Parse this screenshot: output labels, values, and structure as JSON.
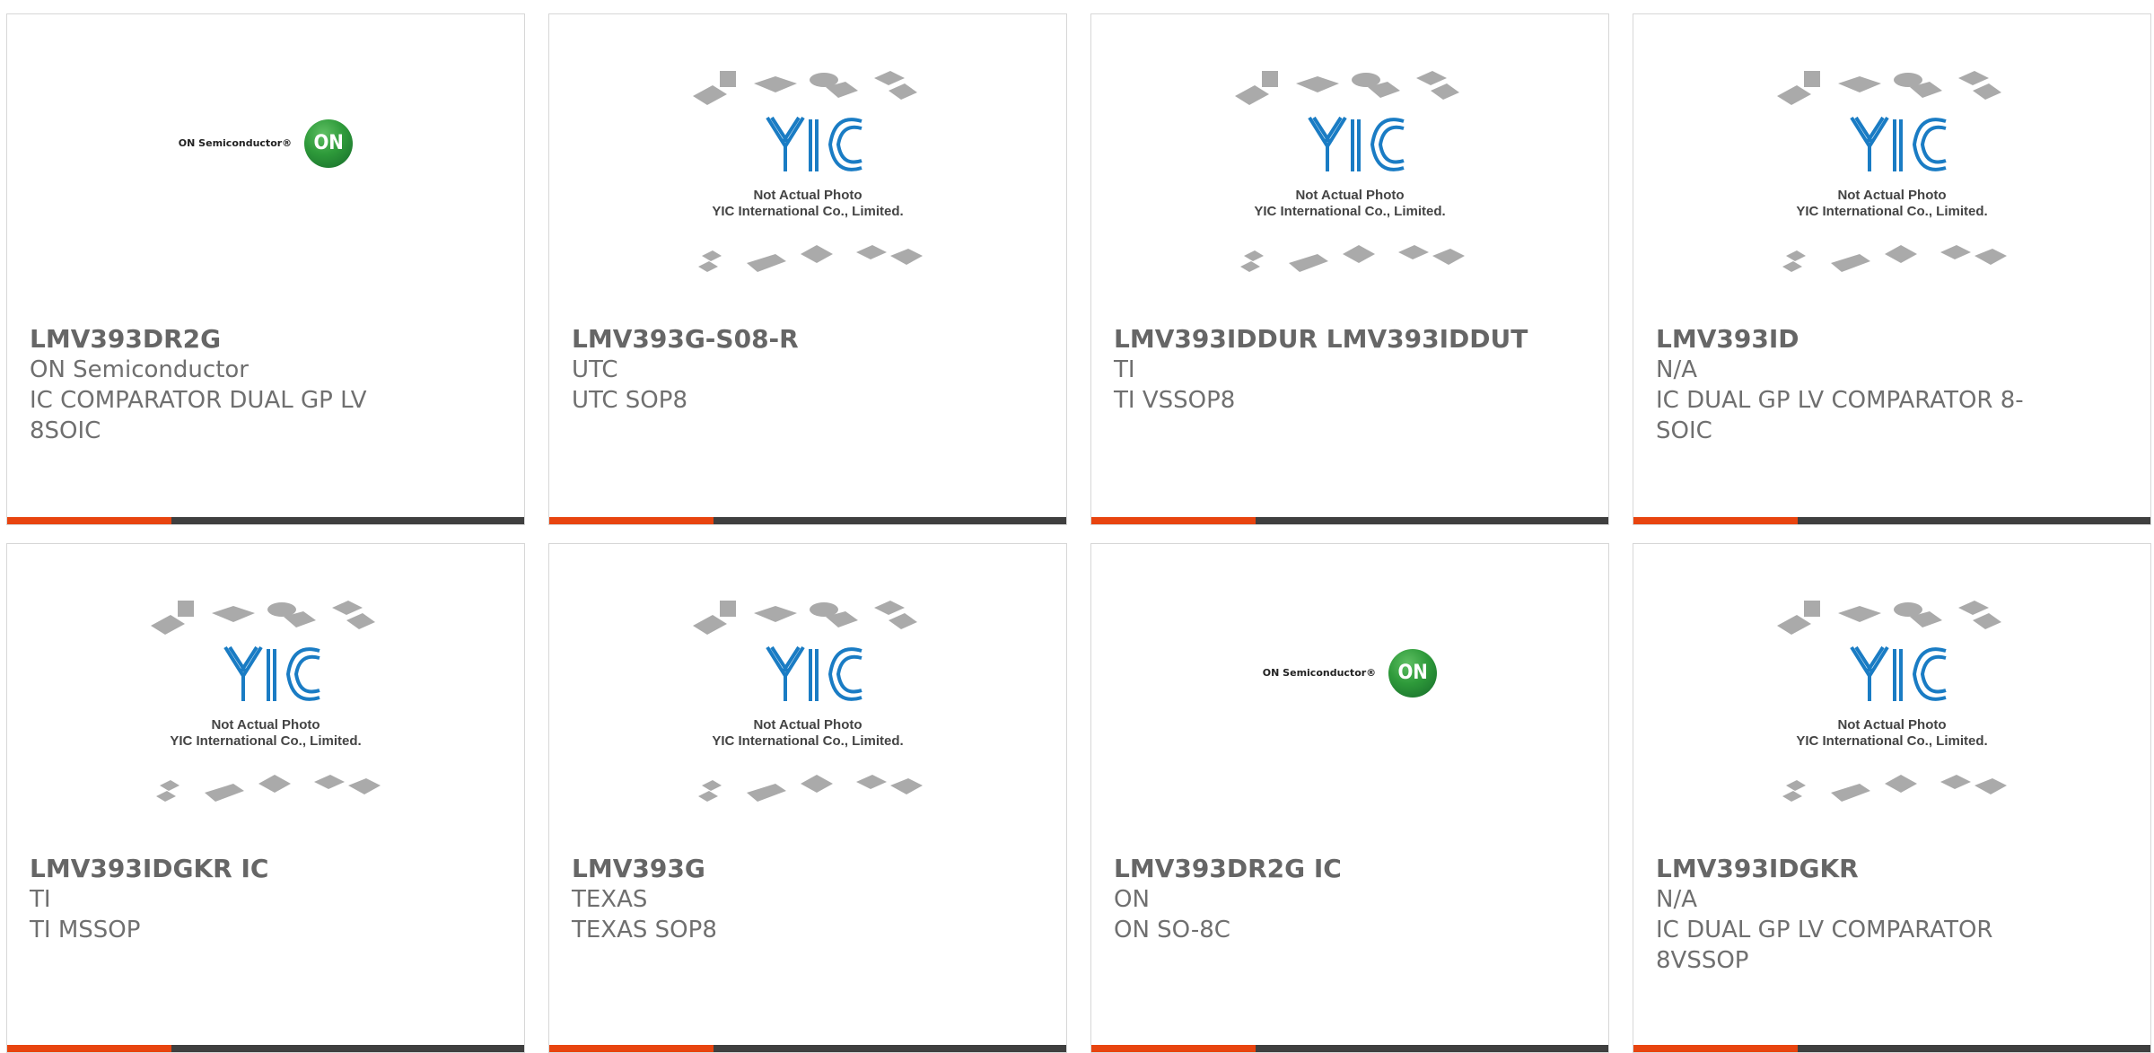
{
  "cards": [
    {
      "part": "LMV393DR2G",
      "maker": "ON Semiconductor",
      "desc1": "IC COMPARATOR DUAL GP LV",
      "desc2": "8SOIC",
      "image": "on-semiconductor-logo"
    },
    {
      "part": "LMV393G-S08-R",
      "maker": "UTC",
      "desc1": "UTC SOP8",
      "desc2": "",
      "image": "yic-placeholder"
    },
    {
      "part": "LMV393IDDUR LMV393IDDUT",
      "maker": "TI",
      "desc1": "TI VSSOP8",
      "desc2": "",
      "image": "yic-placeholder"
    },
    {
      "part": "LMV393ID",
      "maker": "N/A",
      "desc1": "IC DUAL GP LV COMPARATOR 8-",
      "desc2": "SOIC",
      "image": "yic-placeholder"
    },
    {
      "part": "LMV393IDGKR IC",
      "maker": "TI",
      "desc1": "TI MSSOP",
      "desc2": "",
      "image": "yic-placeholder"
    },
    {
      "part": "LMV393G",
      "maker": "TEXAS",
      "desc1": "TEXAS SOP8",
      "desc2": "",
      "image": "yic-placeholder"
    },
    {
      "part": "LMV393DR2G IC",
      "maker": "ON",
      "desc1": "ON SO-8C",
      "desc2": "",
      "image": "on-semiconductor-logo"
    },
    {
      "part": "LMV393IDGKR",
      "maker": "N/A",
      "desc1": "IC DUAL GP LV COMPARATOR",
      "desc2": "8VSSOP",
      "image": "yic-placeholder"
    }
  ],
  "on_logo": {
    "text": "ON Semiconductor®",
    "badge": "ON"
  },
  "yic_placeholder": {
    "line1": "Not Actual Photo",
    "line2": "YIC International Co., Limited."
  },
  "colors": {
    "accent": "#e8440f",
    "bar": "#3f3f3f",
    "text": "#6f6f6f",
    "border": "#d7d7d7",
    "yic_blue": "#1a7cc4"
  }
}
